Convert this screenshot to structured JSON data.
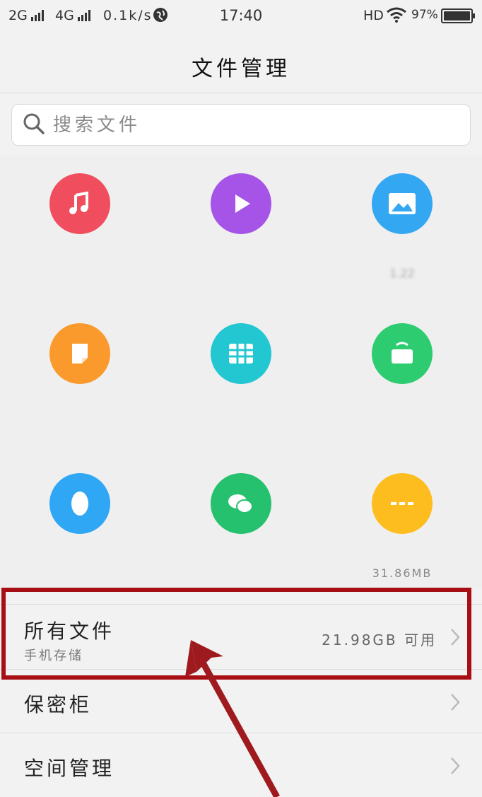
{
  "status_bar": {
    "signal_1": "2G",
    "signal_2": "4G",
    "speed": "0.1k/s",
    "time": "17:40",
    "hd": "HD",
    "battery": "97%"
  },
  "header": {
    "title": "文件管理"
  },
  "search": {
    "placeholder": "搜索文件"
  },
  "categories": [
    {
      "icon": "music-icon",
      "color": "#f04e5e",
      "label": "",
      "size": ""
    },
    {
      "icon": "video-play-icon",
      "color": "#a653e8",
      "label": "",
      "size": ""
    },
    {
      "icon": "image-icon",
      "color": "#34a7f2",
      "label": "",
      "size": "1.22"
    },
    {
      "icon": "document-icon",
      "color": "#fb9a2c",
      "label": "",
      "size": ""
    },
    {
      "icon": "grid-table-icon",
      "color": "#22c7d2",
      "label": "",
      "size": ""
    },
    {
      "icon": "package-icon",
      "color": "#2ecc71",
      "label": "",
      "size": ""
    },
    {
      "icon": "qq-icon",
      "color": "#2fa7f5",
      "label": "",
      "size": ""
    },
    {
      "icon": "wechat-icon",
      "color": "#25c16f",
      "label": "",
      "size": ""
    },
    {
      "icon": "more-dots-icon",
      "color": "#fdbd1f",
      "label": "",
      "size": "31.86MB"
    }
  ],
  "list": {
    "all_files": {
      "title": "所有文件",
      "subtitle": "手机存储",
      "info": "21.98GB 可用"
    },
    "safe": {
      "title": "保密柜"
    },
    "space": {
      "title": "空间管理"
    }
  },
  "colors": {
    "highlight": "#a80f14",
    "arrow": "#9e1a1f"
  }
}
